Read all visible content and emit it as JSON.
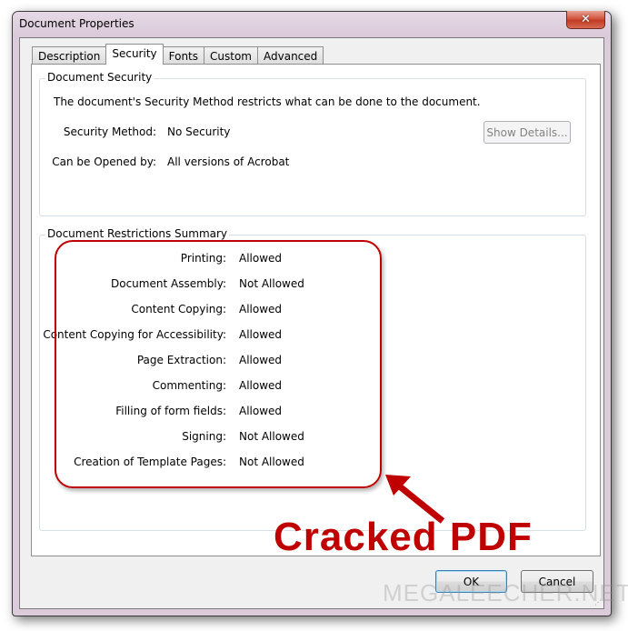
{
  "window": {
    "title": "Document Properties",
    "close_glyph": "✕"
  },
  "tabs": [
    {
      "label": "Description",
      "active": false
    },
    {
      "label": "Security",
      "active": true
    },
    {
      "label": "Fonts",
      "active": false
    },
    {
      "label": "Custom",
      "active": false
    },
    {
      "label": "Advanced",
      "active": false
    }
  ],
  "security": {
    "group_title": "Document Security",
    "description": "The document's Security Method restricts what can be done to the document.",
    "method_label": "Security Method:",
    "method_value": "No Security",
    "opened_label": "Can be Opened by:",
    "opened_value": "All versions of Acrobat",
    "show_details_label": "Show Details..."
  },
  "restrictions": {
    "group_title": "Document Restrictions Summary",
    "rows": [
      {
        "label": "Printing:",
        "value": "Allowed"
      },
      {
        "label": "Document Assembly:",
        "value": "Not Allowed"
      },
      {
        "label": "Content Copying:",
        "value": "Allowed"
      },
      {
        "label": "Content Copying for Accessibility:",
        "value": "Allowed"
      },
      {
        "label": "Page Extraction:",
        "value": "Allowed"
      },
      {
        "label": "Commenting:",
        "value": "Allowed"
      },
      {
        "label": "Filling of form fields:",
        "value": "Allowed"
      },
      {
        "label": "Signing:",
        "value": "Not Allowed"
      },
      {
        "label": "Creation of Template Pages:",
        "value": "Not Allowed"
      }
    ]
  },
  "footer": {
    "ok_label": "OK",
    "cancel_label": "Cancel"
  },
  "annotation": {
    "text": "Cracked PDF",
    "color": "#c00000"
  },
  "watermark": "MEGALEECHER.NET"
}
